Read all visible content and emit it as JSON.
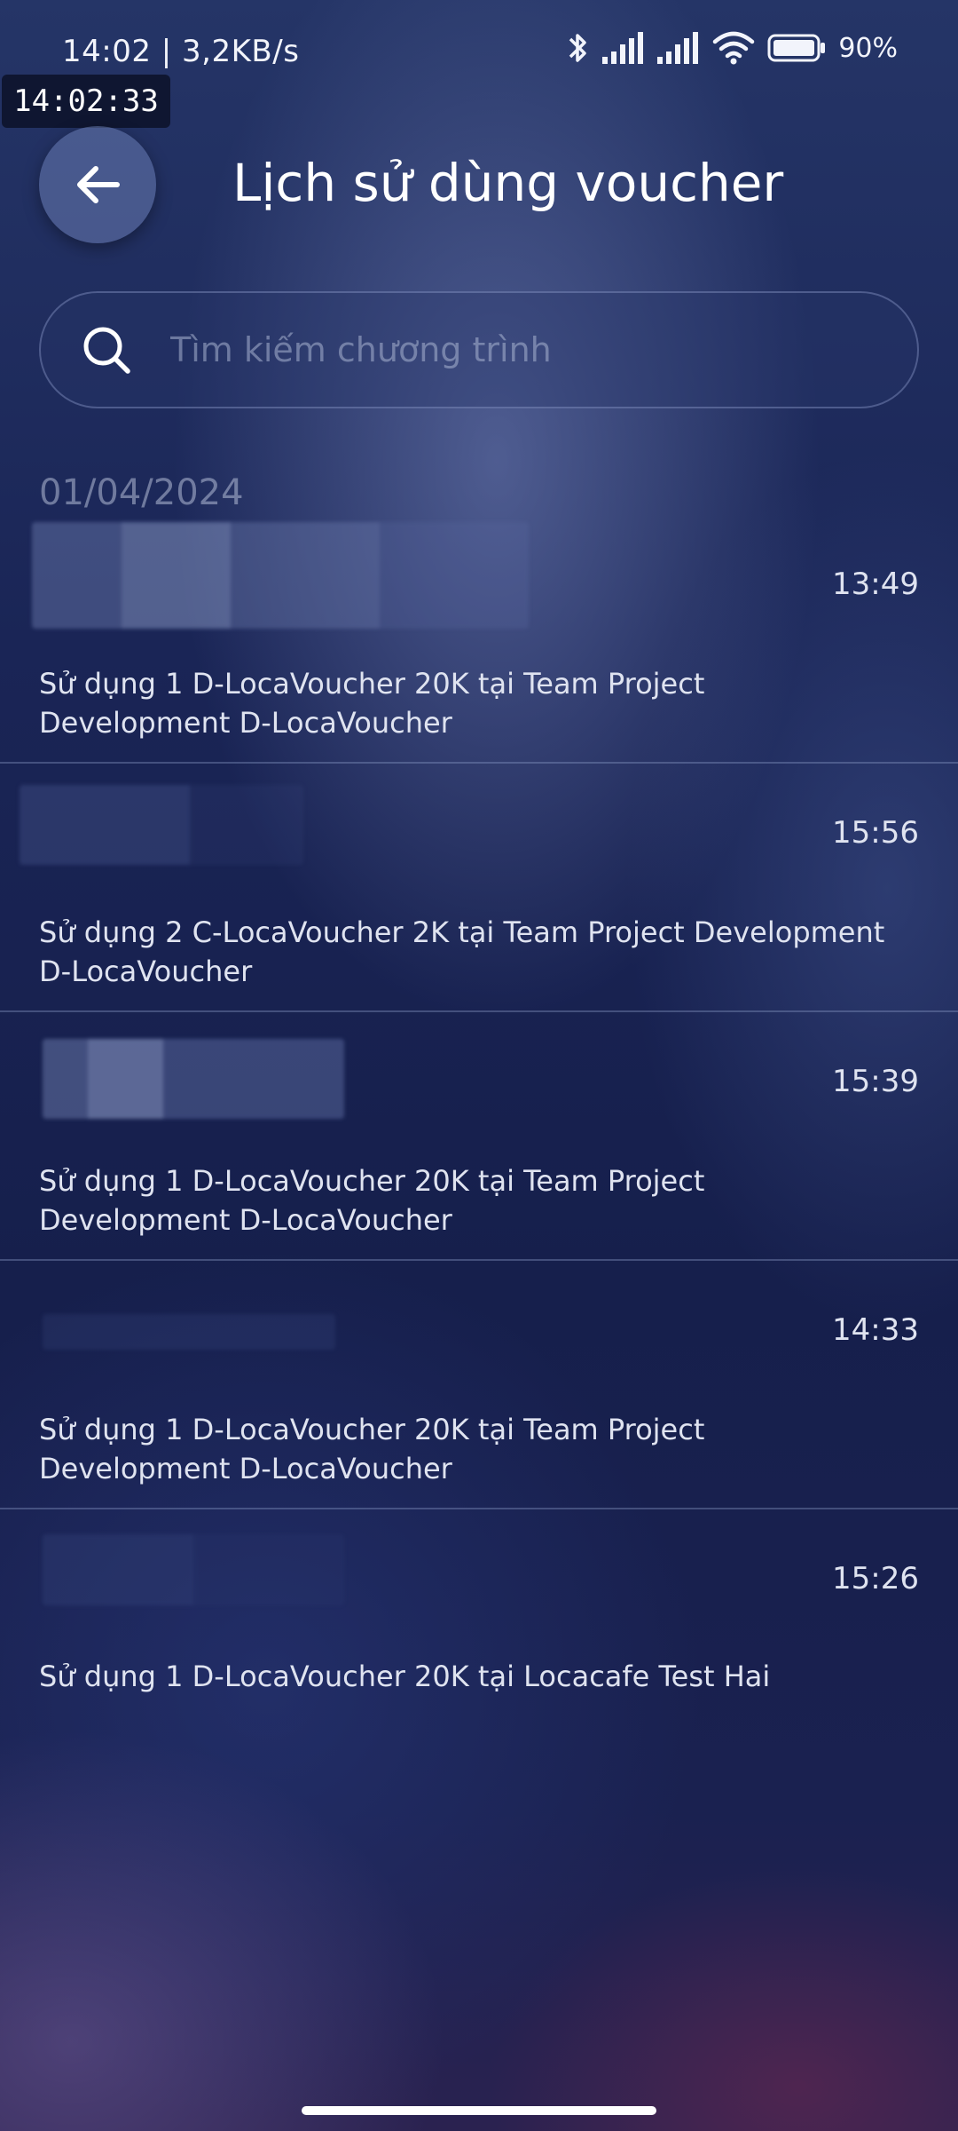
{
  "status_bar": {
    "left_text": "14:02 | 3,2KB/s",
    "battery_percent": "90%",
    "overlay_clock": "14:02:33",
    "icons": [
      "bluetooth-icon",
      "signal-icon",
      "signal-icon",
      "wifi-icon",
      "battery-icon"
    ]
  },
  "header": {
    "title": "Lịch sử dùng voucher",
    "back_icon": "arrow-left-icon"
  },
  "search": {
    "placeholder": "Tìm kiếm chương trình",
    "icon": "search-icon"
  },
  "date_group": "01/04/2024",
  "items": [
    {
      "time": "13:49",
      "description": "Sử dụng 1 D-LocaVoucher 20K tại Team Project Development D-LocaVoucher"
    },
    {
      "time": "15:56",
      "description": "Sử dụng 2 C-LocaVoucher 2K tại Team Project Development D-LocaVoucher"
    },
    {
      "time": "15:39",
      "description": "Sử dụng 1 D-LocaVoucher 20K tại Team Project Development D-LocaVoucher"
    },
    {
      "time": "14:33",
      "description": "Sử dụng 1 D-LocaVoucher 20K tại Team Project Development D-LocaVoucher"
    },
    {
      "time": "15:26",
      "description": "Sử dụng 1 D-LocaVoucher 20K tại Locacafe Test Hai"
    }
  ]
}
